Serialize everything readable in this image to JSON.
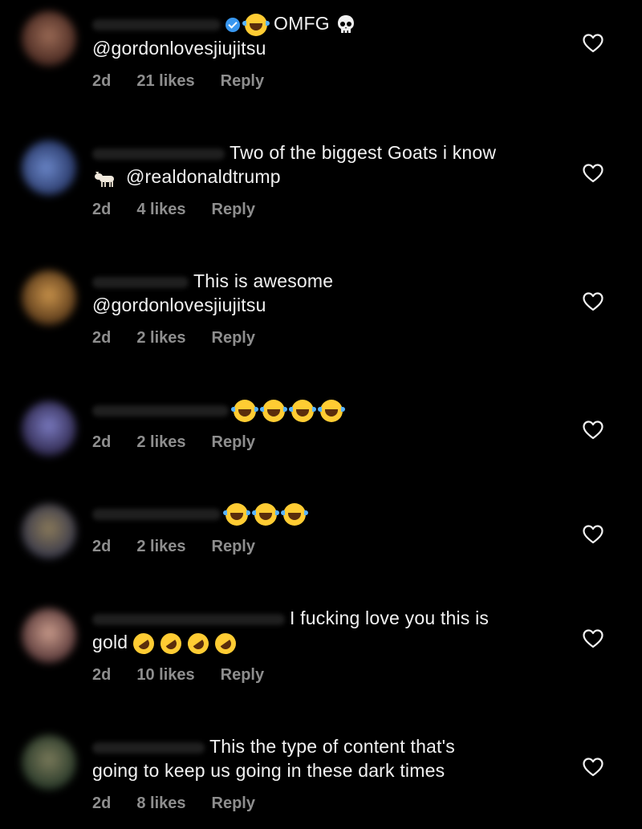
{
  "heart_icon": "heart-outline-icon",
  "colors": {
    "background": "#000000",
    "text": "#f2f2f2",
    "meta": "#8e8e8e",
    "verified": "#3897f0"
  },
  "comments": [
    {
      "text": "OMFG",
      "mention": "@gordonlovesjiujitsu",
      "time": "2d",
      "likes": "21 likes",
      "reply": "Reply"
    },
    {
      "text": "Two of the biggest Goats i know",
      "mention": "@realdonaldtrump",
      "time": "2d",
      "likes": "4 likes",
      "reply": "Reply"
    },
    {
      "text": "This is awesome",
      "mention": "@gordonlovesjiujitsu",
      "time": "2d",
      "likes": "2 likes",
      "reply": "Reply"
    },
    {
      "time": "2d",
      "likes": "2 likes",
      "reply": "Reply"
    },
    {
      "time": "2d",
      "likes": "2 likes",
      "reply": "Reply"
    },
    {
      "text": "I fucking love you this is",
      "text2": "gold",
      "time": "2d",
      "likes": "10 likes",
      "reply": "Reply"
    },
    {
      "text": "This the type of content that's",
      "text2": "going to keep us going in these dark times",
      "time": "2d",
      "likes": "8 likes",
      "reply": "Reply"
    }
  ]
}
